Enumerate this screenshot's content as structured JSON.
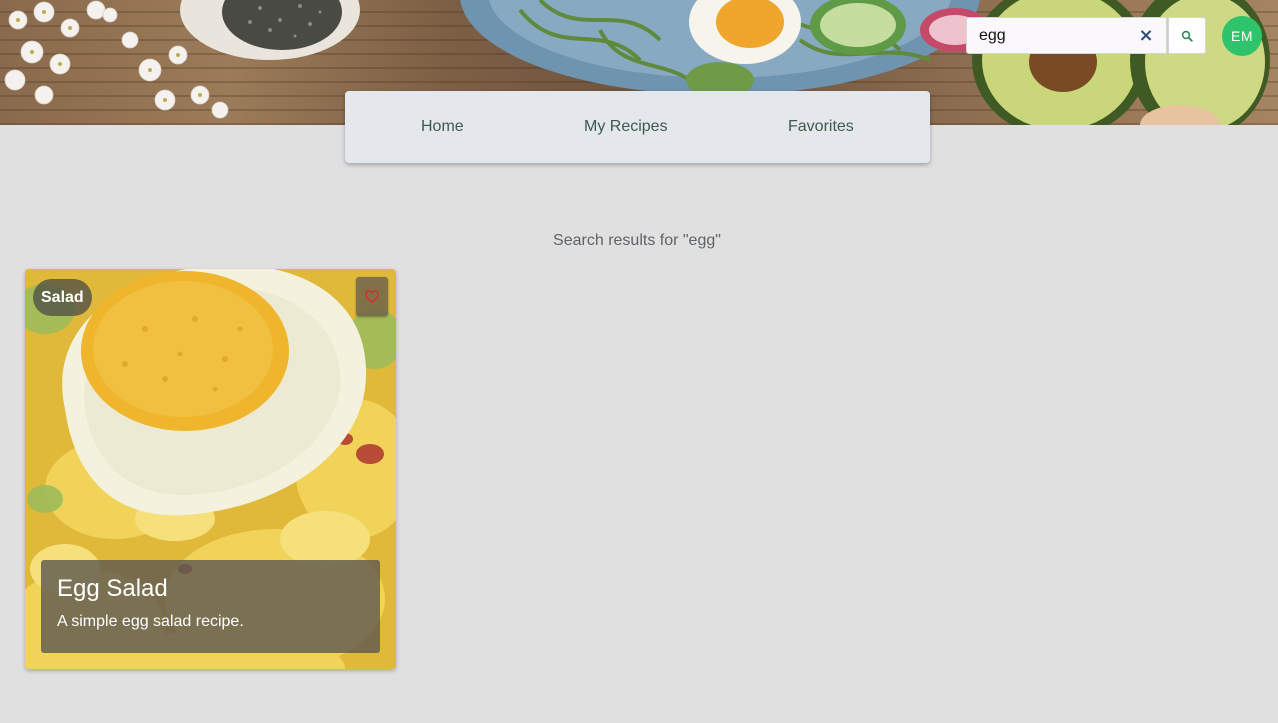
{
  "search": {
    "value": "egg",
    "clear_icon": "×",
    "clear_label": "clear search",
    "search_label": "search"
  },
  "user": {
    "initials": "EM",
    "avatar_color": "#2fc46c"
  },
  "nav": {
    "items": [
      {
        "label": "Home"
      },
      {
        "label": "My Recipes"
      },
      {
        "label": "Favorites"
      }
    ]
  },
  "results": {
    "heading": "Search results for \"egg\"",
    "cards": [
      {
        "category": "Salad",
        "title": "Egg Salad",
        "description": "A simple egg salad recipe.",
        "favorite_icon": "heart-outline-icon"
      }
    ]
  },
  "colors": {
    "page_background": "#e0e0e0",
    "nav_background": "#e4e8ec",
    "nav_text": "#3e5a4c",
    "heart": "#d32f2f",
    "search_icon": "#2e8b57"
  }
}
